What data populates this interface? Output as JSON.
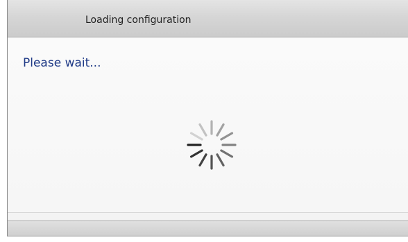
{
  "window": {
    "title": "Loading configuration"
  },
  "content": {
    "message": "Please wait..."
  },
  "spinner": {
    "icon": "loading-spinner-icon",
    "segment_count": 12,
    "active_color": "#222222",
    "faded_color": "#d0d0d0"
  },
  "colors": {
    "message_text": "#1f3a86",
    "titlebar_top": "#e4e4e4",
    "titlebar_bottom": "#cbcbcb"
  }
}
